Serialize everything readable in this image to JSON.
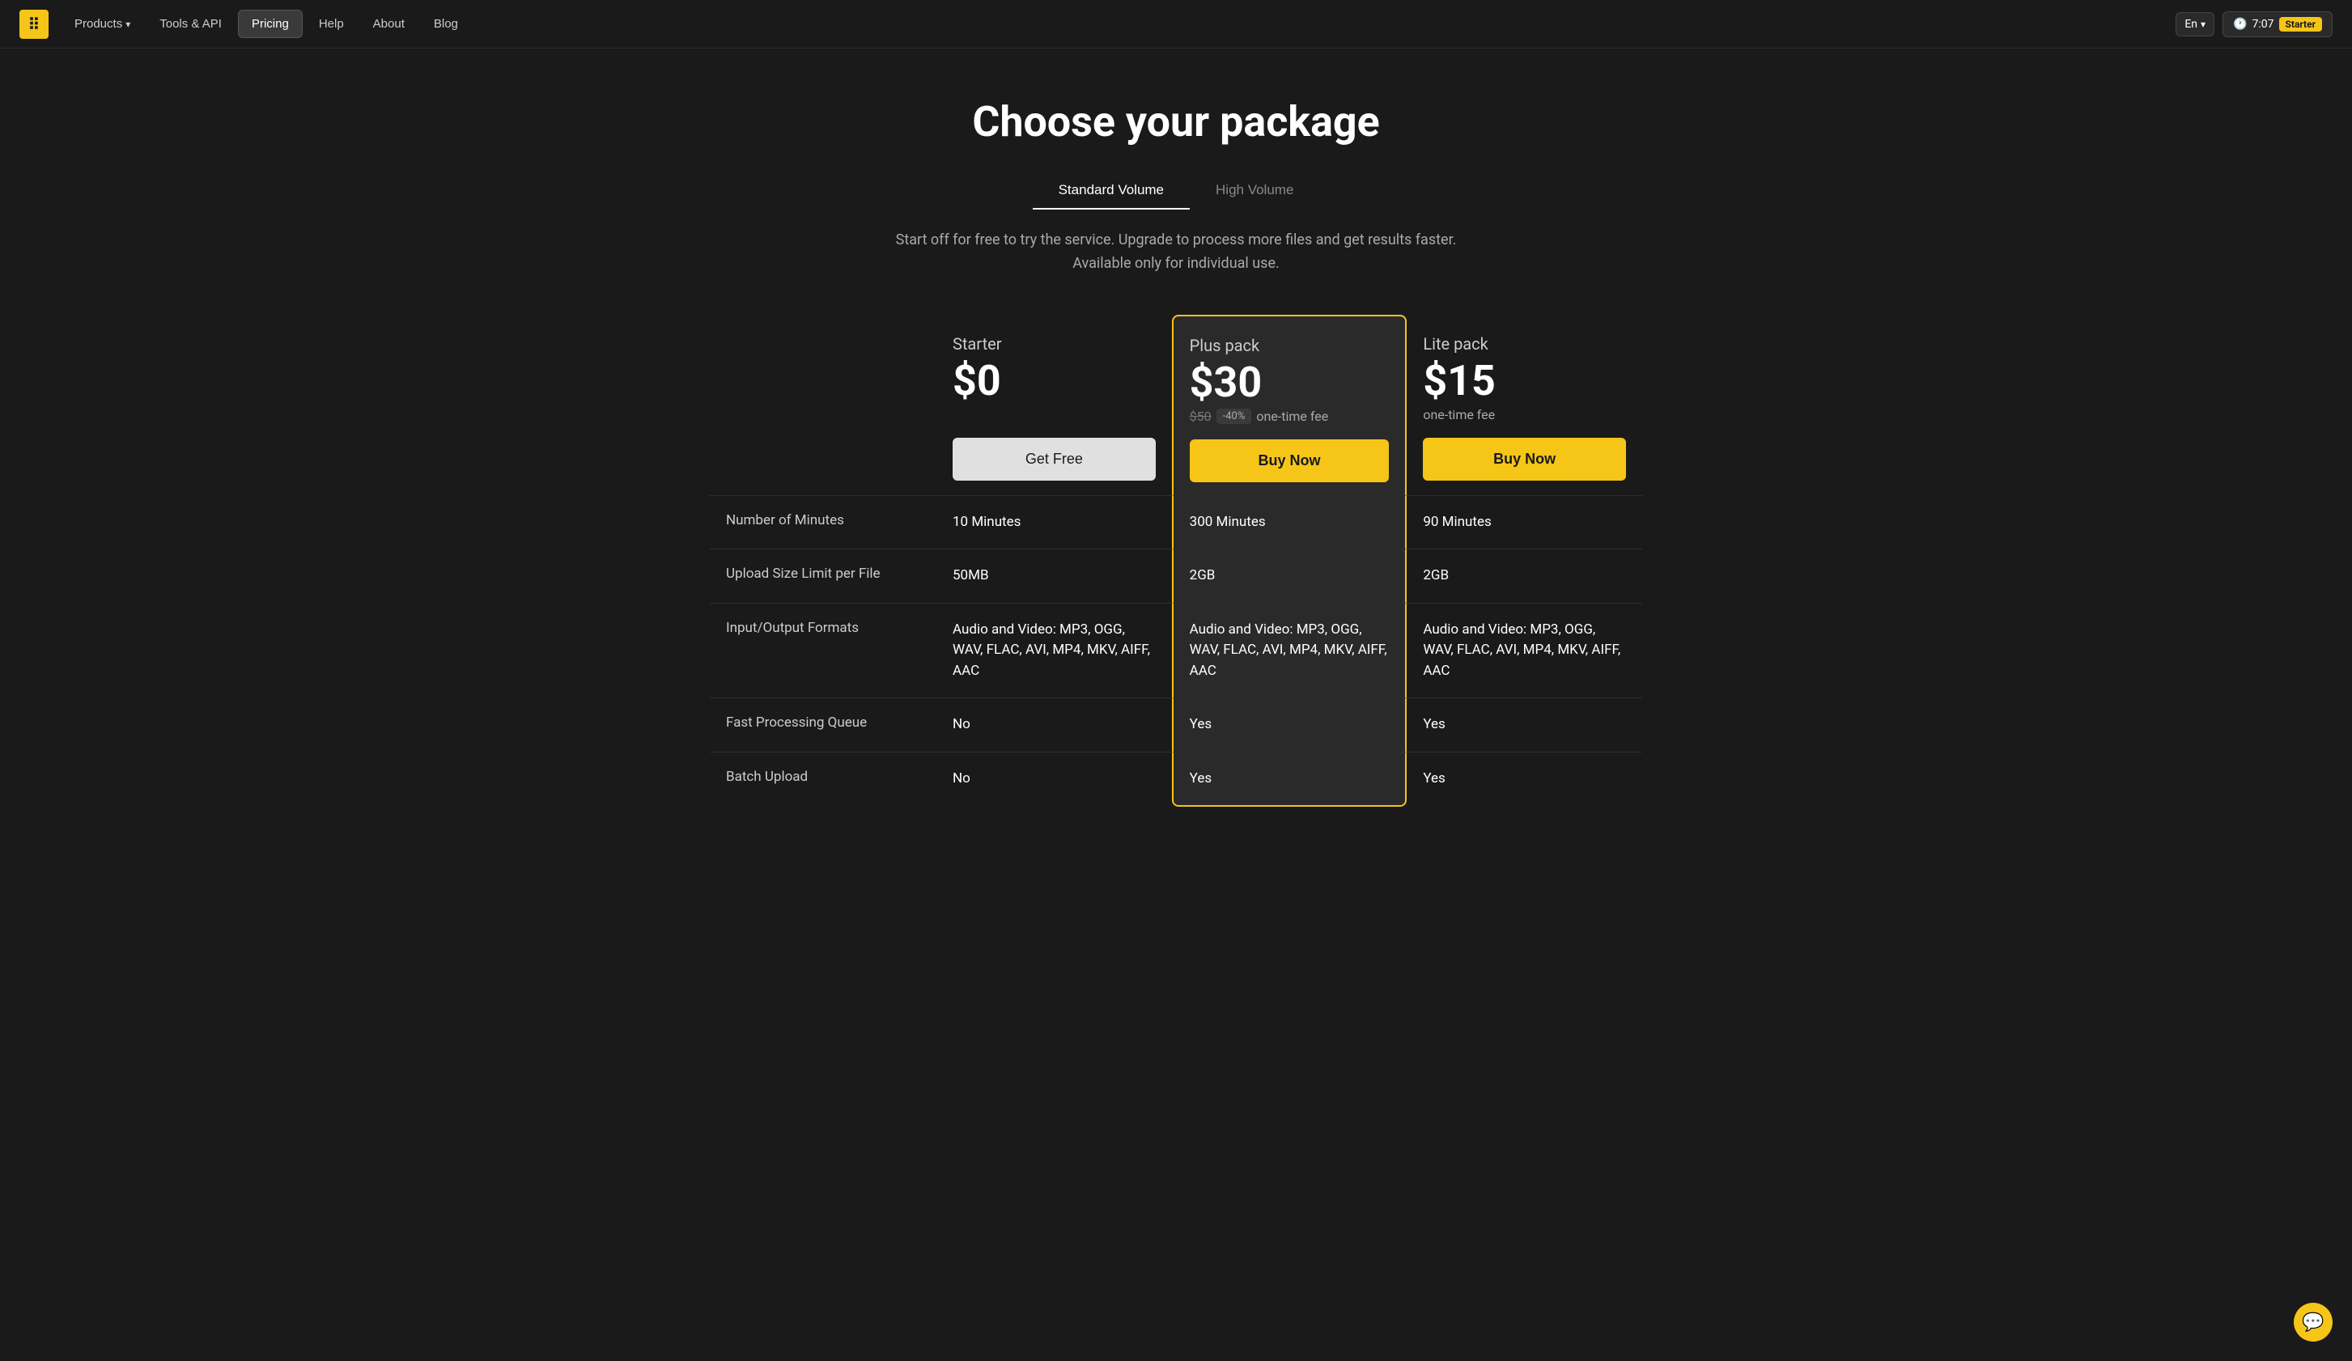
{
  "navbar": {
    "logo_symbol": "⠿",
    "links": [
      {
        "id": "products",
        "label": "Products",
        "has_dropdown": true,
        "active": false
      },
      {
        "id": "tools-api",
        "label": "Tools & API",
        "has_dropdown": false,
        "active": false
      },
      {
        "id": "pricing",
        "label": "Pricing",
        "has_dropdown": false,
        "active": true
      },
      {
        "id": "help",
        "label": "Help",
        "has_dropdown": false,
        "active": false
      },
      {
        "id": "about",
        "label": "About",
        "has_dropdown": false,
        "active": false
      },
      {
        "id": "blog",
        "label": "Blog",
        "has_dropdown": false,
        "active": false
      }
    ],
    "language": "En",
    "timer": "7:07",
    "plan_badge": "Starter"
  },
  "page": {
    "title": "Choose your package",
    "tabs": [
      {
        "id": "standard",
        "label": "Standard Volume",
        "active": true
      },
      {
        "id": "high",
        "label": "High Volume",
        "active": false
      }
    ],
    "subtitle": "Start off for free to try the service. Upgrade to process more files and get results faster. Available only for individual use."
  },
  "plans": {
    "label_col_placeholder": "",
    "columns": [
      {
        "id": "starter",
        "name": "Starter",
        "price": "$0",
        "price_original": "",
        "discount": "",
        "price_suffix": "",
        "cta_label": "Get Free",
        "cta_type": "free",
        "featured": false
      },
      {
        "id": "plus",
        "name": "Plus pack",
        "price": "$30",
        "price_original": "$50",
        "discount": "-40%",
        "price_suffix": "one-time fee",
        "cta_label": "Buy Now",
        "cta_type": "buy",
        "featured": true
      },
      {
        "id": "lite",
        "name": "Lite pack",
        "price": "$15",
        "price_original": "",
        "discount": "",
        "price_suffix": "one-time fee",
        "cta_label": "Buy Now",
        "cta_type": "buy",
        "featured": false
      }
    ],
    "features": [
      {
        "id": "minutes",
        "label": "Number of Minutes",
        "values": [
          "10 Minutes",
          "300 Minutes",
          "90 Minutes"
        ]
      },
      {
        "id": "upload-size",
        "label": "Upload Size Limit per File",
        "values": [
          "50MB",
          "2GB",
          "2GB"
        ]
      },
      {
        "id": "formats",
        "label": "Input/Output Formats",
        "values": [
          "Audio and Video: MP3, OGG, WAV, FLAC, AVI, MP4, MKV, AIFF, AAC",
          "Audio and Video: MP3, OGG, WAV, FLAC, AVI, MP4, MKV, AIFF, AAC",
          "Audio and Video: MP3, OGG, WAV, FLAC, AVI, MP4, MKV, AIFF, AAC"
        ]
      },
      {
        "id": "fast-queue",
        "label": "Fast Processing Queue",
        "values": [
          "No",
          "Yes",
          "Yes"
        ]
      },
      {
        "id": "batch-upload",
        "label": "Batch Upload",
        "values": [
          "No",
          "Yes",
          "Yes"
        ]
      }
    ]
  },
  "chat": {
    "icon": "💬"
  }
}
